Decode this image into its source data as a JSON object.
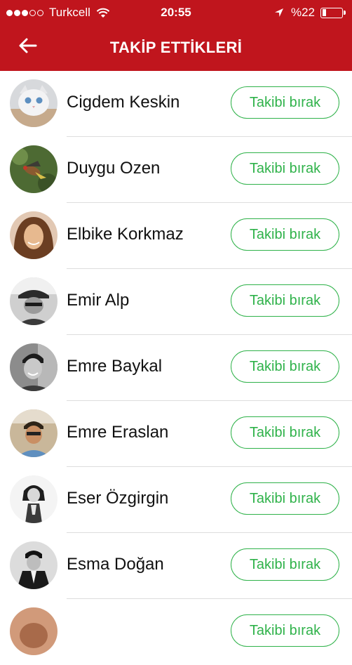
{
  "status_bar": {
    "carrier": "Turkcell",
    "time": "20:55",
    "battery": "%22",
    "signal_bars_filled": 3,
    "signal_bars_total": 5
  },
  "header": {
    "title": "TAKİP ETTİKLERİ",
    "back_icon": "arrow-left-icon",
    "color": "#c0151d"
  },
  "list": {
    "button_color": "#2fb24a",
    "items": [
      {
        "name": "Cigdem Keskin",
        "button": "Takibi bırak"
      },
      {
        "name": "Duygu Ozen",
        "button": "Takibi bırak"
      },
      {
        "name": "Elbike Korkmaz",
        "button": "Takibi bırak"
      },
      {
        "name": "Emir Alp",
        "button": "Takibi bırak"
      },
      {
        "name": "Emre Baykal",
        "button": "Takibi bırak"
      },
      {
        "name": "Emre Eraslan",
        "button": "Takibi bırak"
      },
      {
        "name": "Eser Özgirgin",
        "button": "Takibi bırak"
      },
      {
        "name": "Esma Doğan",
        "button": "Takibi bırak"
      },
      {
        "name": "",
        "button": "Takibi bırak"
      }
    ]
  }
}
